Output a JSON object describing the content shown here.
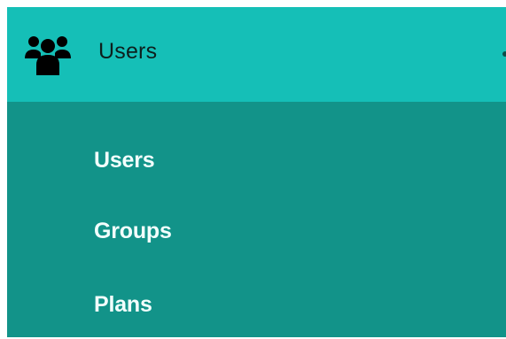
{
  "menu": {
    "header": {
      "icon": "users-icon",
      "label": "Users"
    },
    "items": [
      {
        "label": "Users"
      },
      {
        "label": "Groups"
      },
      {
        "label": "Plans"
      }
    ]
  },
  "colors": {
    "header_background": "#15bfb7",
    "submenu_background": "#129389",
    "submenu_text": "#f2fffd",
    "header_text": "#0d1f1d"
  }
}
